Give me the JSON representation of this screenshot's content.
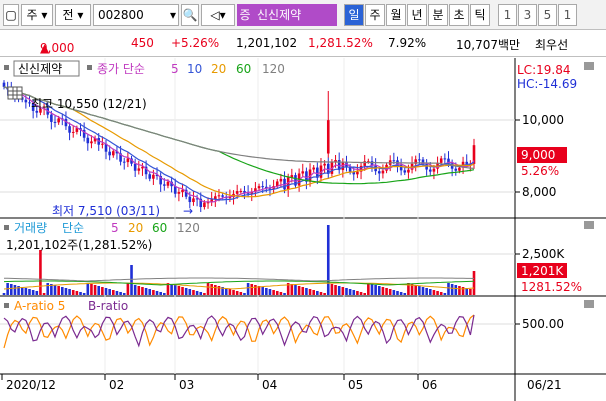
{
  "toolbar": {
    "market": "주",
    "search_label": "전",
    "code": "002800",
    "stock_name": "신신제약",
    "tag_badge": "증",
    "periods": [
      "일",
      "주",
      "월",
      "년",
      "분",
      "초",
      "틱"
    ],
    "active_period": "일",
    "intervals": [
      "1",
      "3",
      "5",
      "1"
    ]
  },
  "status": {
    "price": "9,000",
    "change": "450",
    "change_pct": "+5.26%",
    "volume": "1,201,102",
    "volume_ratio": "1,281.52%",
    "turnover": "7.92%",
    "trade_value": "10,707백만",
    "broker": "최우선"
  },
  "price_panel": {
    "legend_name": "신신제약",
    "legend_ma": "종가 단순",
    "ma_periods": [
      "5",
      "10",
      "20",
      "60",
      "120"
    ],
    "lc": "LC:19.84",
    "hc": "HC:-14.69",
    "high_label": "최고 10,550 (12/21)",
    "low_label": "최저 7,510 (03/11)",
    "axis_ticks": [
      "10,000",
      "8,000"
    ],
    "price_tag": "9,000",
    "pct_tag": "5.26%"
  },
  "volume_panel": {
    "legend": "거래량",
    "legend_ma": "단순",
    "ma_periods": [
      "5",
      "20",
      "60",
      "120"
    ],
    "value_line": "1,201,102주(1,281.52%)",
    "axis_tick": "2,500K",
    "vol_tag": "1,201K",
    "pct_tag": "1281.52%"
  },
  "ratio_panel": {
    "legend_a": "A-ratio 5",
    "legend_b": "B-ratio",
    "axis_tick": "500.00"
  },
  "xaxis": {
    "labels": [
      "2020/12",
      "02",
      "03",
      "04",
      "05",
      "06"
    ],
    "right_label": "06/21"
  },
  "colors": {
    "up": "#e8001c",
    "down": "#1f2fd6",
    "ma5": "#c03ac0",
    "ma10": "#3555d6",
    "ma20": "#e79a00",
    "ma60": "#18a418",
    "ma120": "#808080",
    "a_ratio": "#ff8a00",
    "b_ratio": "#7a2a90"
  },
  "chart_data": {
    "type": "candlestick",
    "high": 10550,
    "low": 7510,
    "last_close": 9000,
    "y_range": [
      7300,
      10900
    ]
  }
}
